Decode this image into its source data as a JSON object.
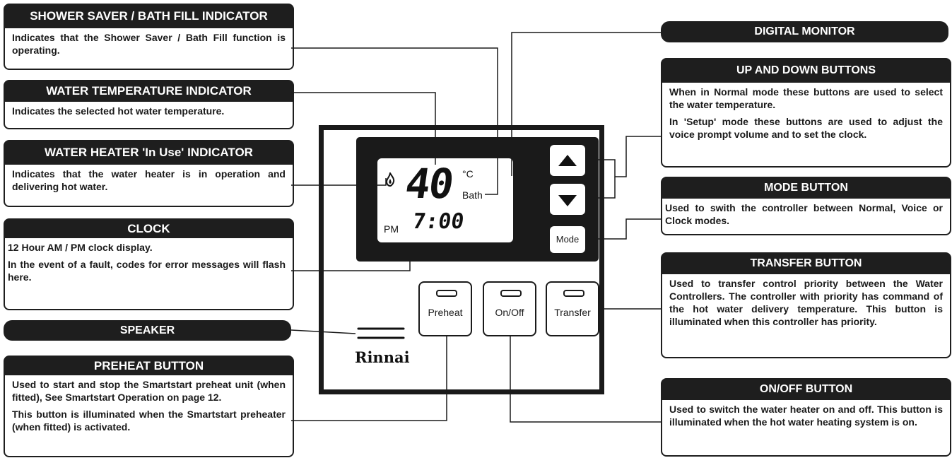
{
  "callouts": {
    "shower_saver": {
      "title": "SHOWER SAVER / BATH FILL INDICATOR",
      "body": [
        "Indicates that the Shower Saver / Bath Fill function is operating."
      ]
    },
    "water_temp": {
      "title": "WATER TEMPERATURE INDICATOR",
      "body": [
        "Indicates the selected hot water temperature."
      ]
    },
    "in_use": {
      "title": "WATER HEATER 'In Use' INDICATOR",
      "body": [
        "Indicates that the water heater is in operation and delivering hot water."
      ]
    },
    "clock": {
      "title": "CLOCK",
      "body": [
        "12 Hour AM / PM clock display.",
        "In the event of a fault, codes for error messages will flash here."
      ]
    },
    "speaker": {
      "title": "SPEAKER"
    },
    "preheat": {
      "title": "PREHEAT BUTTON",
      "body": [
        "Used to start and stop the Smartstart preheat unit (when fitted), See Smartstart Operation on page 12.",
        "This button is illuminated when the Smartstart preheater (when fitted) is activated."
      ]
    },
    "digital_monitor": {
      "title": "DIGITAL MONITOR"
    },
    "up_down": {
      "title": "UP AND DOWN BUTTONS",
      "body": [
        "When in Normal mode these buttons are used to select the water temperature.",
        "In 'Setup' mode these buttons are used to adjust the voice prompt volume and to set the clock."
      ]
    },
    "mode": {
      "title": "MODE BUTTON",
      "body": [
        "Used to swith the controller between Normal, Voice or Clock modes."
      ]
    },
    "transfer": {
      "title": "TRANSFER BUTTON",
      "body": [
        "Used to transfer control priority between the Water Controllers. The controller with priority has command of the hot water delivery temperature. This button is illuminated when this controller has priority."
      ]
    },
    "onoff": {
      "title": "ON/OFF BUTTON",
      "body": [
        "Used to switch the water heater on and off. This button is illuminated when the hot water heating system is on."
      ]
    }
  },
  "controller": {
    "temperature": "40",
    "unit": "°C",
    "bath": "Bath",
    "ampm": "PM",
    "time": "7:00",
    "mode_label": "Mode",
    "preheat_label": "Preheat",
    "onoff_label": "On/Off",
    "transfer_label": "Transfer",
    "brand": "Rinnai"
  }
}
